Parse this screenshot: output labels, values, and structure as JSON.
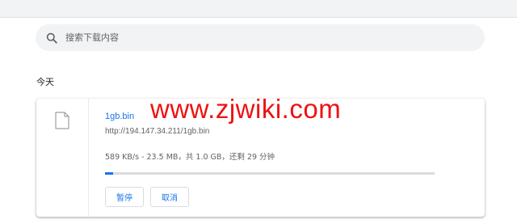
{
  "search": {
    "placeholder": "搜索下载内容",
    "value": ""
  },
  "section": {
    "title": "今天"
  },
  "download": {
    "file_name": "1gb.bin",
    "url": "http://194.147.34.211/1gb.bin",
    "status": "589 KB/s - 23.5 MB，共 1.0 GB，还剩 29 分钟",
    "progress": 0.0235,
    "pause_label": "暂停",
    "cancel_label": "取消"
  },
  "watermark": {
    "text": "www.zjwiki.com"
  },
  "colors": {
    "accent": "#1a73e8",
    "watermark": "#ee1111"
  },
  "icons": {
    "search": "search-icon",
    "file": "file-icon"
  }
}
